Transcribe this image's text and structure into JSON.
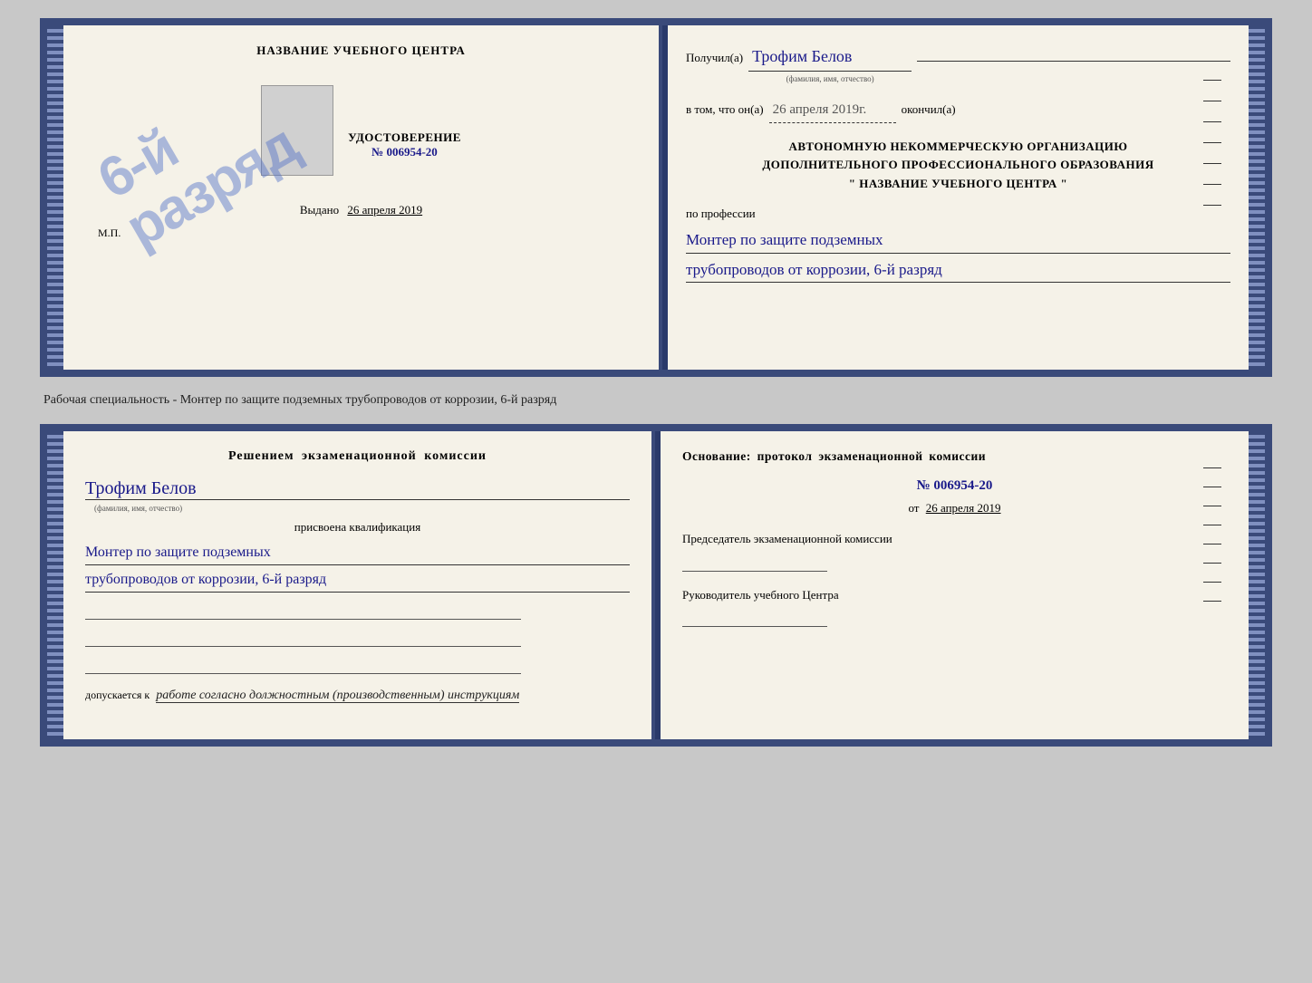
{
  "upper_doc": {
    "left": {
      "institution_title": "НАЗВАНИЕ УЧЕБНОГО ЦЕНТРА",
      "cert_title": "УДОСТОВЕРЕНИЕ",
      "cert_number": "№ 006954-20",
      "issued_label": "Выдано",
      "issued_date": "26 апреля 2019",
      "mp_label": "М.П.",
      "stamp_line1": "6-й",
      "stamp_line2": "разряд"
    },
    "right": {
      "received_prefix": "Получил(а)",
      "recipient_name": "Трофим Белов",
      "name_label": "(фамилия, имя, отчество)",
      "completed_prefix": "в том, что он(а)",
      "completed_date": "26 апреля 2019г.",
      "completed_suffix": "окончил(а)",
      "org_line1": "АВТОНОМНУЮ НЕКОММЕРЧЕСКУЮ ОРГАНИЗАЦИЮ",
      "org_line2": "ДОПОЛНИТЕЛЬНОГО ПРОФЕССИОНАЛЬНОГО ОБРАЗОВАНИЯ",
      "org_line3": "\" НАЗВАНИЕ УЧЕБНОГО ЦЕНТРА \"",
      "profession_label": "по профессии",
      "profession_line1": "Монтер по защите подземных",
      "profession_line2": "трубопроводов от коррозии, 6-й разряд"
    }
  },
  "middle_label": "Рабочая специальность - Монтер по защите подземных трубопроводов от коррозии, 6-й разряд",
  "lower_doc": {
    "left": {
      "commission_title": "Решением экзаменационной комиссии",
      "person_name": "Трофим Белов",
      "name_label": "(фамилия, имя, отчество)",
      "assigned_text": "присвоена квалификация",
      "qual_line1": "Монтер по защите подземных",
      "qual_line2": "трубопроводов от коррозии, 6-й разряд",
      "allowed_prefix": "допускается к",
      "allowed_text": "работе согласно должностным (производственным) инструкциям"
    },
    "right": {
      "basis_title": "Основание: протокол экзаменационной комиссии",
      "protocol_number": "№ 006954-20",
      "protocol_date_prefix": "от",
      "protocol_date": "26 апреля 2019",
      "chair_title": "Председатель экзаменационной комиссии",
      "edu_head_title": "Руководитель учебного Центра"
    }
  }
}
